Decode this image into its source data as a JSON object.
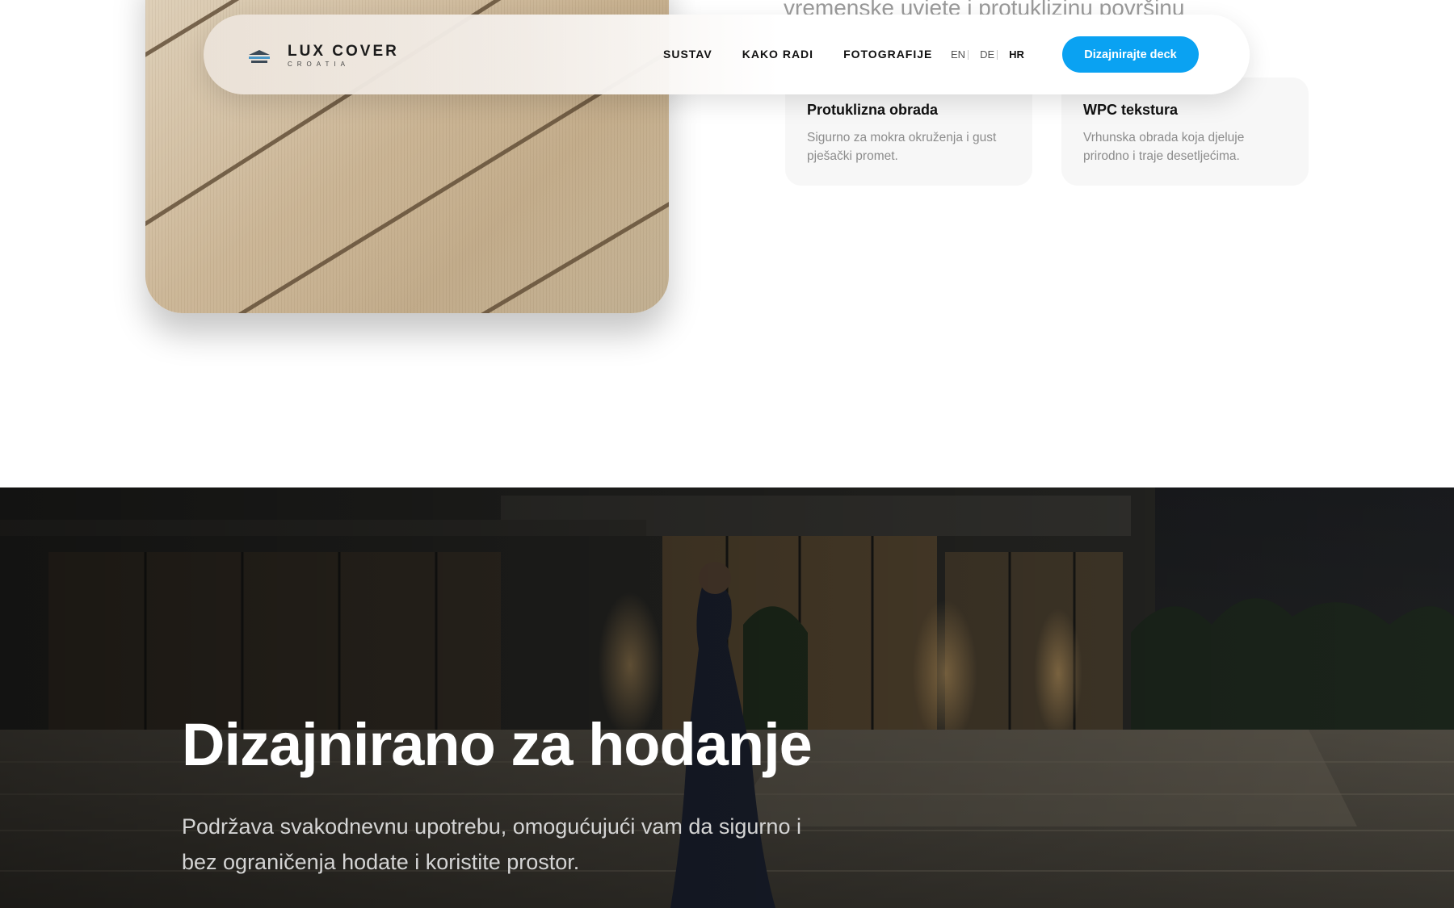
{
  "nav": {
    "brand_name": "LUX COVER",
    "brand_sub": "CROATIA",
    "links": [
      "SUSTAV",
      "KAKO RADI",
      "FOTOGRAFIJE"
    ],
    "languages": [
      "EN",
      "DE",
      "HR"
    ],
    "active_language": "HR",
    "cta_label": "Dizajnirajte deck",
    "cta_color": "#0aa2f2"
  },
  "top_section": {
    "cut_heading": "vremenske uvjete i protuklizinu površinu",
    "features": [
      {
        "title": "Protuklizna obrada",
        "text": "Sigurno za mokra okruženja i gust pješački promet."
      },
      {
        "title": "WPC tekstura",
        "text": "Vrhunska obrada koja djeluje prirodno i traje desetljećima."
      }
    ]
  },
  "hero": {
    "title": "Dizajnirano za hodanje",
    "text": "Podržava svakodnevnu upotrebu, omogućujući vam da sigurno i bez ograničenja hodate i koristite prostor."
  }
}
